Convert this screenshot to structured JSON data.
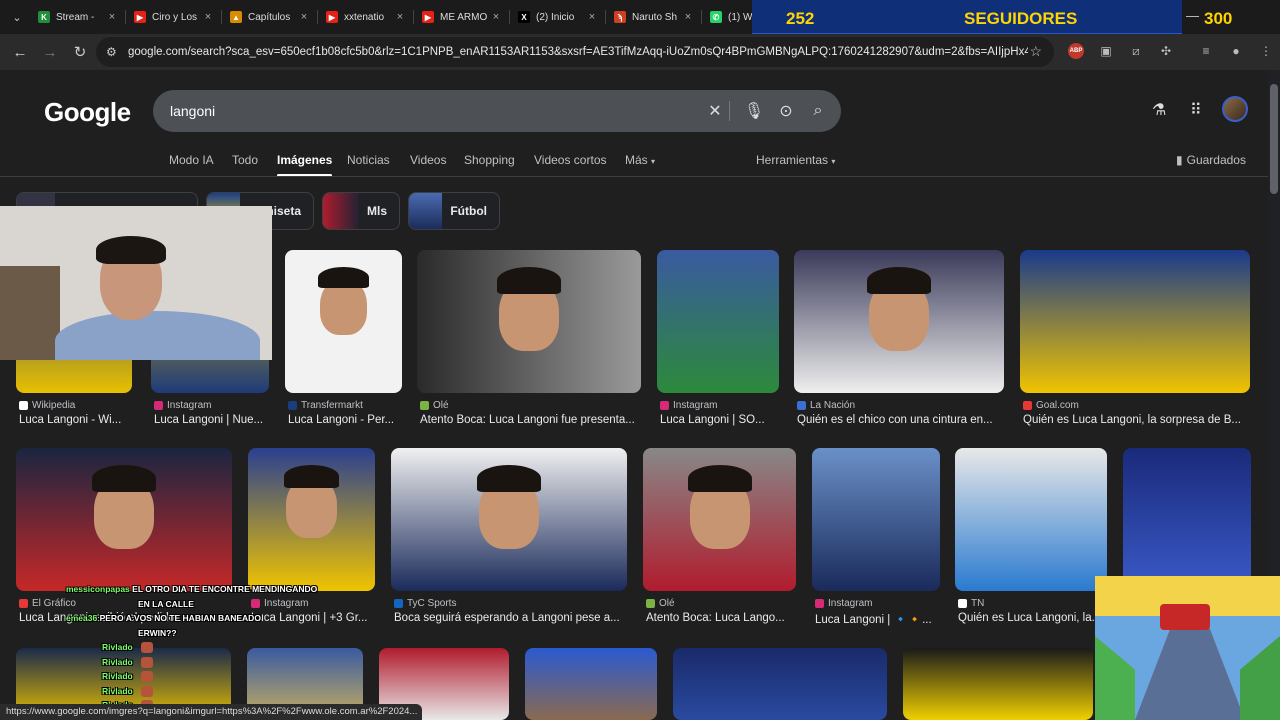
{
  "tabs": [
    {
      "label": "Stream -",
      "color": "#1f8f3a",
      "glyph": "K"
    },
    {
      "label": "Ciro y Los",
      "color": "#e62117",
      "glyph": "▶"
    },
    {
      "label": "Capítulos",
      "color": "#d98c00",
      "glyph": "▲"
    },
    {
      "label": "xxtenatio",
      "color": "#e62117",
      "glyph": "▶"
    },
    {
      "label": "ME ARMO",
      "color": "#e62117",
      "glyph": "▶"
    },
    {
      "label": "(2) Inicio",
      "color": "#000000",
      "glyph": "X"
    },
    {
      "label": "Naruto Sh",
      "color": "#d04020",
      "glyph": "ϡ"
    },
    {
      "label": "(1) WhatsApp",
      "color": "#25d366",
      "glyph": "✆"
    }
  ],
  "banner": {
    "count": "252",
    "label": "SEGUIDORES",
    "goal": "300"
  },
  "url": "google.com/search?sca_esv=650ecf1b08cfc5b0&rlz=1C1PNPB_enAR1153AR1153&sxsrf=AE3TifMzAqq-iUoZm0sQr4BPmGMBNgALPQ:1760241282907&udm=2&fbs=AIIjpHx4nJjf...",
  "google": {
    "logo": "Google",
    "query": "langoni"
  },
  "navtabs": [
    "Modo IA",
    "Todo",
    "Imágenes",
    "Noticias",
    "Videos",
    "Shopping",
    "Videos cortos",
    "Más"
  ],
  "tools": "Herramientas",
  "saved": "Guardados",
  "chips": [
    {
      "label": "Camiseta"
    },
    {
      "label": "Mls"
    },
    {
      "label": "Fútbol"
    }
  ],
  "row1": [
    {
      "source": "Wikipedia",
      "title": "Luca Langoni - Wi...",
      "fav": "#ffffff"
    },
    {
      "source": "Instagram",
      "title": "Luca Langoni | Nue...",
      "fav": "#d62976"
    },
    {
      "source": "Transfermarkt",
      "title": "Luca Langoni - Per...",
      "fav": "#1a3d7c"
    },
    {
      "source": "Olé",
      "title": "Atento Boca: Luca Langoni fue presenta...",
      "fav": "#7cb342"
    },
    {
      "source": "Instagram",
      "title": "Luca Langoni | SO...",
      "fav": "#d62976"
    },
    {
      "source": "La Nación",
      "title": "Quién es el chico con una cintura en...",
      "fav": "#3b6fd1"
    },
    {
      "source": "Goal.com",
      "title": "Quién es Luca Langoni, la sorpresa de B...",
      "fav": "#e53935"
    }
  ],
  "row2": [
    {
      "source": "El Gráfico",
      "title": "Luca Langoni recibió el pedido...",
      "fav": "#e53935"
    },
    {
      "source": "Instagram",
      "title": "Luca Langoni | +3 Gr...",
      "fav": "#d62976"
    },
    {
      "source": "TyC Sports",
      "title": "Boca seguirá esperando a Langoni pese a...",
      "fav": "#1565c0"
    },
    {
      "source": "Olé",
      "title": "Atento Boca: Luca Lango...",
      "fav": "#7cb342"
    },
    {
      "source": "Instagram",
      "title": "Luca Langoni | 🔹🔸...",
      "fav": "#d62976"
    },
    {
      "source": "TN",
      "title": "Quién es Luca Langoni, la...",
      "fav": "#ffffff"
    }
  ],
  "chat": [
    {
      "user": "messiconpapas",
      "msg": "EL OTRO DIA TE ENCONTRE MENDINGANDO"
    },
    {
      "user": "",
      "msg": "EN LA CALLE"
    },
    {
      "user": "emea36",
      "msg": "PERO A VOS NO TE HABIAN BANEADO"
    },
    {
      "user": "",
      "msg": "ERWIN??"
    },
    {
      "user": "Rivlado",
      "msg": ""
    },
    {
      "user": "Rivlado",
      "msg": ""
    },
    {
      "user": "Rivlado",
      "msg": ""
    },
    {
      "user": "Rivlado",
      "msg": ""
    },
    {
      "user": "Rivlado",
      "msg": ""
    }
  ],
  "status": "https://www.google.com/imgres?q=langoni&imgurl=https%3A%2F%2Fwww.ole.com.ar%2F2024..."
}
